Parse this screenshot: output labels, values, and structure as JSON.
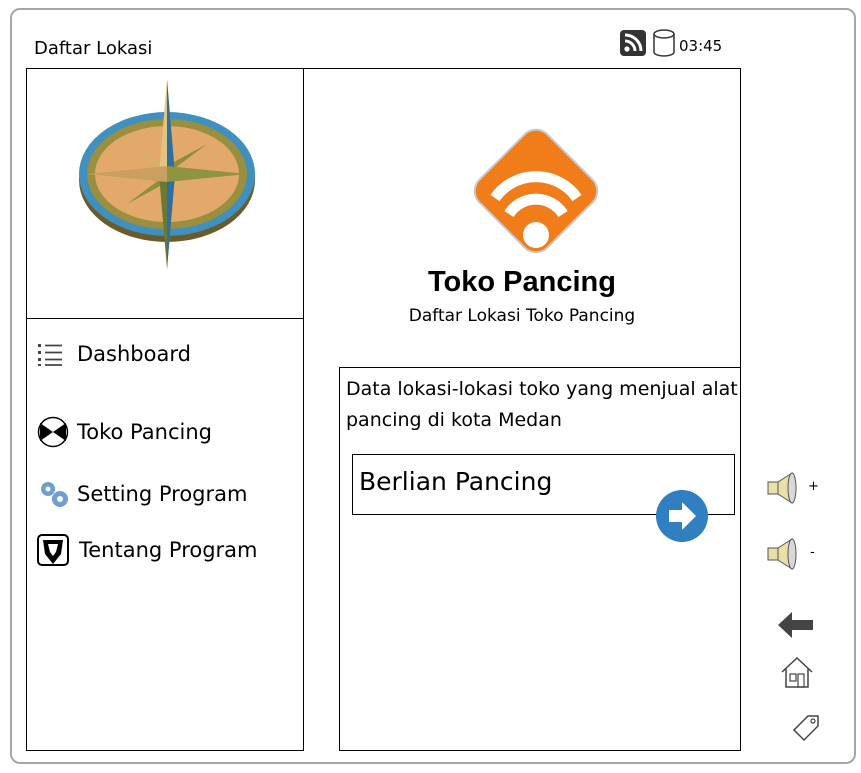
{
  "window": {
    "title": "Daftar Lokasi"
  },
  "status_bar": {
    "time": "03:45",
    "icons": [
      "rss-icon",
      "database-icon"
    ]
  },
  "sidebar": {
    "items": [
      {
        "label": "Dashboard",
        "icon": "list-icon"
      },
      {
        "label": "Toko Pancing",
        "icon": "bowtie-icon"
      },
      {
        "label": "Setting Program",
        "icon": "gears-icon"
      },
      {
        "label": "Tentang Program",
        "icon": "shield-icon"
      }
    ]
  },
  "header": {
    "app_name": "Toko Pancing",
    "subtitle": "Daftar Lokasi Toko Pancing"
  },
  "content": {
    "description": "Data lokasi-lokasi toko yang menjual alat pancing di kota Medan",
    "locations": [
      {
        "name": "Berlian Pancing"
      }
    ]
  },
  "side_controls": {
    "volume_up_label": "+",
    "volume_down_label": "-"
  },
  "colors": {
    "accent_orange": "#f07c1a",
    "go_button_blue": "#2f7fc1",
    "border": "#a6a6a6"
  }
}
